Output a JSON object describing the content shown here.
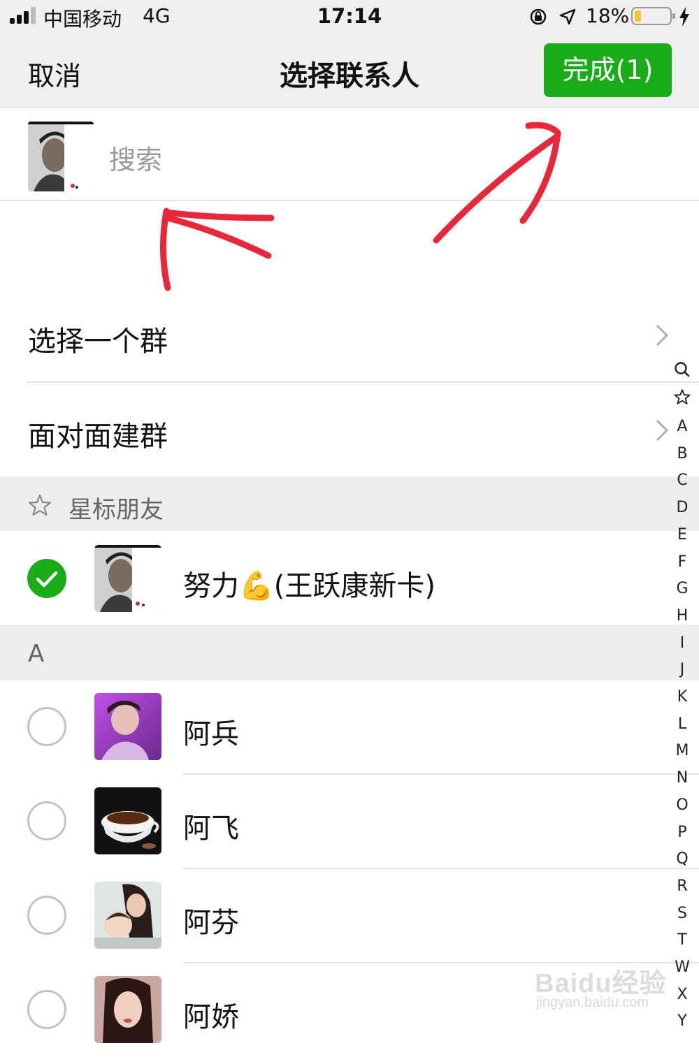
{
  "status_bar": {
    "carrier": "中国移动",
    "network": "4G",
    "time": "17:14",
    "battery": "18%",
    "battery_level": 0.18
  },
  "nav": {
    "cancel": "取消",
    "title": "选择联系人",
    "done": "完成(1)"
  },
  "search": {
    "placeholder": "搜索"
  },
  "menu": [
    {
      "label": "选择一个群"
    },
    {
      "label": "面对面建群"
    }
  ],
  "starred": {
    "header": "星标朋友",
    "contacts": [
      {
        "name": "努力💪(王跃康新卡)",
        "selected": true
      }
    ]
  },
  "section_a": {
    "header": "A",
    "contacts": [
      {
        "name": "阿兵",
        "selected": false
      },
      {
        "name": "阿飞",
        "selected": false
      },
      {
        "name": "阿芬",
        "selected": false
      },
      {
        "name": "阿娇",
        "selected": false
      }
    ]
  },
  "index": [
    "A",
    "B",
    "C",
    "D",
    "E",
    "F",
    "G",
    "H",
    "I",
    "J",
    "K",
    "L",
    "M",
    "N",
    "O",
    "P",
    "Q",
    "R",
    "S",
    "T",
    "W",
    "X",
    "Y"
  ],
  "watermark": {
    "brand": "Baidu经验",
    "url": "jingyan.baidu.com"
  },
  "colors": {
    "accent_green": "#1aad19",
    "annotation_red": "#e8283a",
    "battery_yellow": "#f7c52a"
  }
}
